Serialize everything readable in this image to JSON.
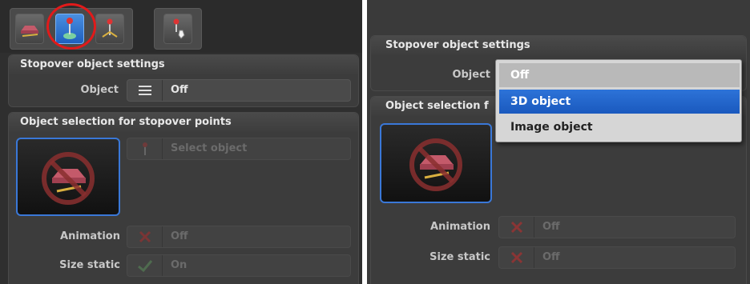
{
  "left": {
    "section1_title": "Stopover object settings",
    "object_label": "Object",
    "object_value": "Off",
    "section2_title": "Object selection for stopover points",
    "select_object_label": "Select object",
    "animation_label": "Animation",
    "animation_value": "Off",
    "size_static_label": "Size static",
    "size_static_value": "On"
  },
  "right": {
    "section1_title": "Stopover object settings",
    "object_label": "Object",
    "section2_title": "Object selection f",
    "animation_label": "Animation",
    "animation_value": "Off",
    "size_static_label": "Size static",
    "size_static_value": "Off",
    "dropdown": {
      "options": [
        "Off",
        "3D object",
        "Image object"
      ],
      "selected": "Off",
      "highlighted": "3D object"
    }
  },
  "colors": {
    "highlight_ring": "#e11a1a",
    "accent_blue": "#2d73d8",
    "off_icon_red": "#c03030",
    "on_icon_green": "#4caf50"
  },
  "icons": [
    "car-tool-icon",
    "pin-tool-icon",
    "pin-flag-tool-icon",
    "pin-hand-tool-icon",
    "list-icon",
    "x-icon",
    "check-icon",
    "no-object-icon"
  ]
}
